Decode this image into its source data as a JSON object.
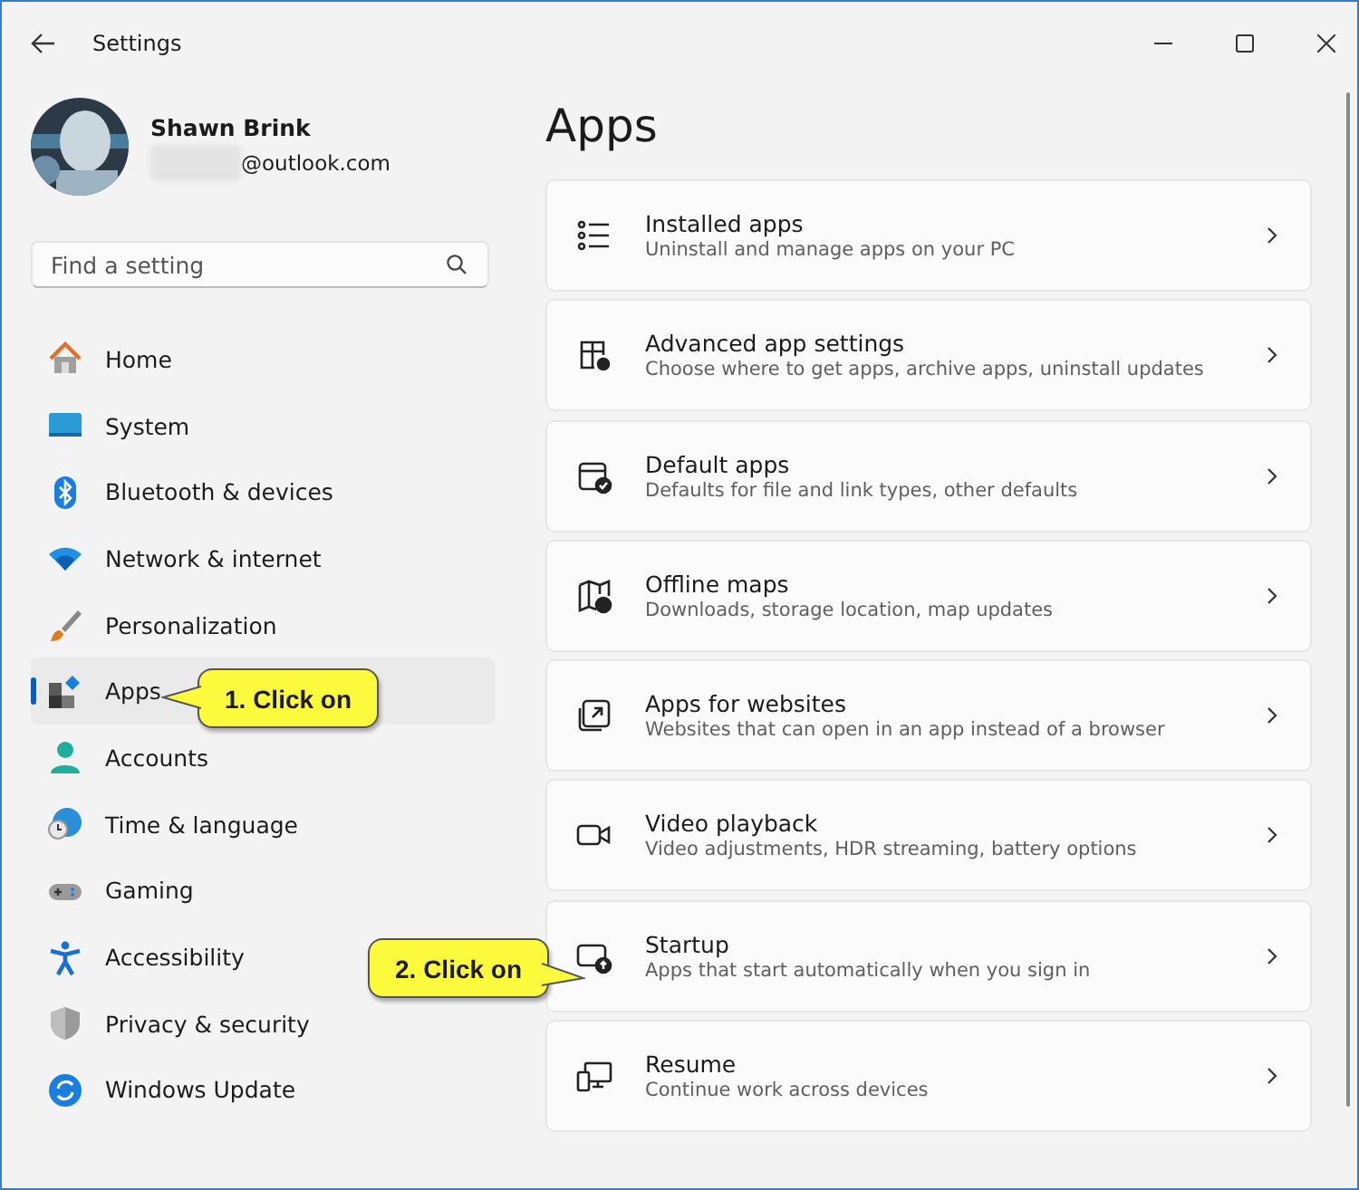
{
  "window": {
    "title": "Settings"
  },
  "profile": {
    "name": "Shawn Brink",
    "email": "@outlook.com"
  },
  "search": {
    "placeholder": "Find a setting"
  },
  "nav": [
    {
      "label": "Home",
      "selected": false
    },
    {
      "label": "System",
      "selected": false
    },
    {
      "label": "Bluetooth & devices",
      "selected": false
    },
    {
      "label": "Network & internet",
      "selected": false
    },
    {
      "label": "Personalization",
      "selected": false
    },
    {
      "label": "Apps",
      "selected": true
    },
    {
      "label": "Accounts",
      "selected": false
    },
    {
      "label": "Time & language",
      "selected": false
    },
    {
      "label": "Gaming",
      "selected": false
    },
    {
      "label": "Accessibility",
      "selected": false
    },
    {
      "label": "Privacy & security",
      "selected": false
    },
    {
      "label": "Windows Update",
      "selected": false
    }
  ],
  "page_title": "Apps",
  "cards": [
    {
      "title": "Installed apps",
      "subtitle": "Uninstall and manage apps on your PC"
    },
    {
      "title": "Advanced app settings",
      "subtitle": "Choose where to get apps, archive apps, uninstall updates"
    },
    {
      "title": "Default apps",
      "subtitle": "Defaults for file and link types, other defaults"
    },
    {
      "title": "Offline maps",
      "subtitle": "Downloads, storage location, map updates"
    },
    {
      "title": "Apps for websites",
      "subtitle": "Websites that can open in an app instead of a browser"
    },
    {
      "title": "Video playback",
      "subtitle": "Video adjustments, HDR streaming, battery options"
    },
    {
      "title": "Startup",
      "subtitle": "Apps that start automatically when you sign in"
    },
    {
      "title": "Resume",
      "subtitle": "Continue work across devices"
    }
  ],
  "callouts": [
    {
      "text": "1. Click on"
    },
    {
      "text": "2. Click on"
    }
  ]
}
